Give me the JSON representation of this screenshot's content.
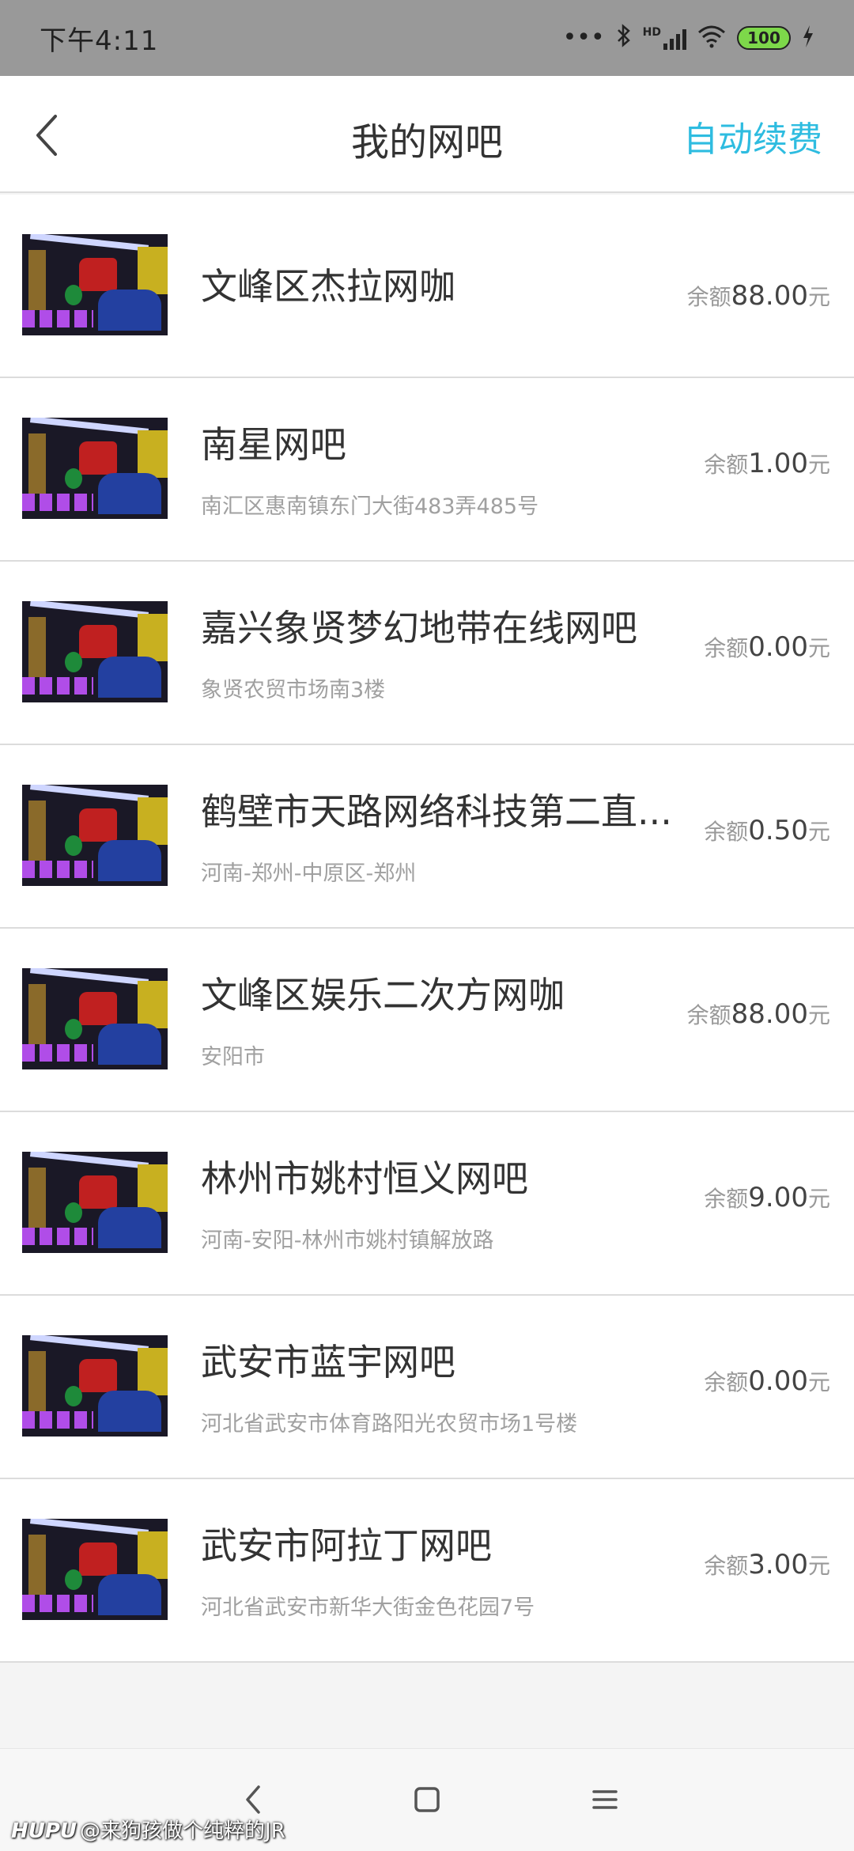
{
  "status_bar": {
    "time": "下午4:11",
    "icons": [
      "more-dots-icon",
      "bluetooth-icon",
      "hd-signal-icon",
      "wifi-icon",
      "battery-icon",
      "charging-icon"
    ],
    "hd_label": "HD",
    "battery_level": "100"
  },
  "header": {
    "title": "我的网吧",
    "back_icon": "chevron-left-icon",
    "action_label": "自动续费",
    "action_color": "#2ebce0"
  },
  "balance_label": "余额",
  "balance_unit": "元",
  "items": [
    {
      "name": "文峰区杰拉网咖",
      "address": "",
      "amount": "88.00"
    },
    {
      "name": "南星网吧",
      "address": "南汇区惠南镇东门大街483弄485号",
      "amount": "1.00"
    },
    {
      "name": "嘉兴象贤梦幻地带在线网吧",
      "address": "象贤农贸市场南3楼",
      "amount": "0.00"
    },
    {
      "name": "鹤壁市天路网络科技第二直...",
      "address": "河南-郑州-中原区-郑州",
      "amount": "0.50"
    },
    {
      "name": "文峰区娱乐二次方网咖",
      "address": "安阳市",
      "amount": "88.00"
    },
    {
      "name": "林州市姚村恒义网吧",
      "address": "河南-安阳-林州市姚村镇解放路",
      "amount": "9.00"
    },
    {
      "name": "武安市蓝宇网吧",
      "address": "河北省武安市体育路阳光农贸市场1号楼",
      "amount": "0.00"
    },
    {
      "name": "武安市阿拉丁网吧",
      "address": "河北省武安市新华大街金色花园7号",
      "amount": "3.00"
    }
  ],
  "nav_bar": {
    "buttons": [
      "nav-back-icon",
      "nav-home-icon",
      "nav-menu-icon"
    ]
  },
  "watermark": {
    "logo": "HUPU",
    "text": "@来狗孩做个纯粹的JR"
  }
}
